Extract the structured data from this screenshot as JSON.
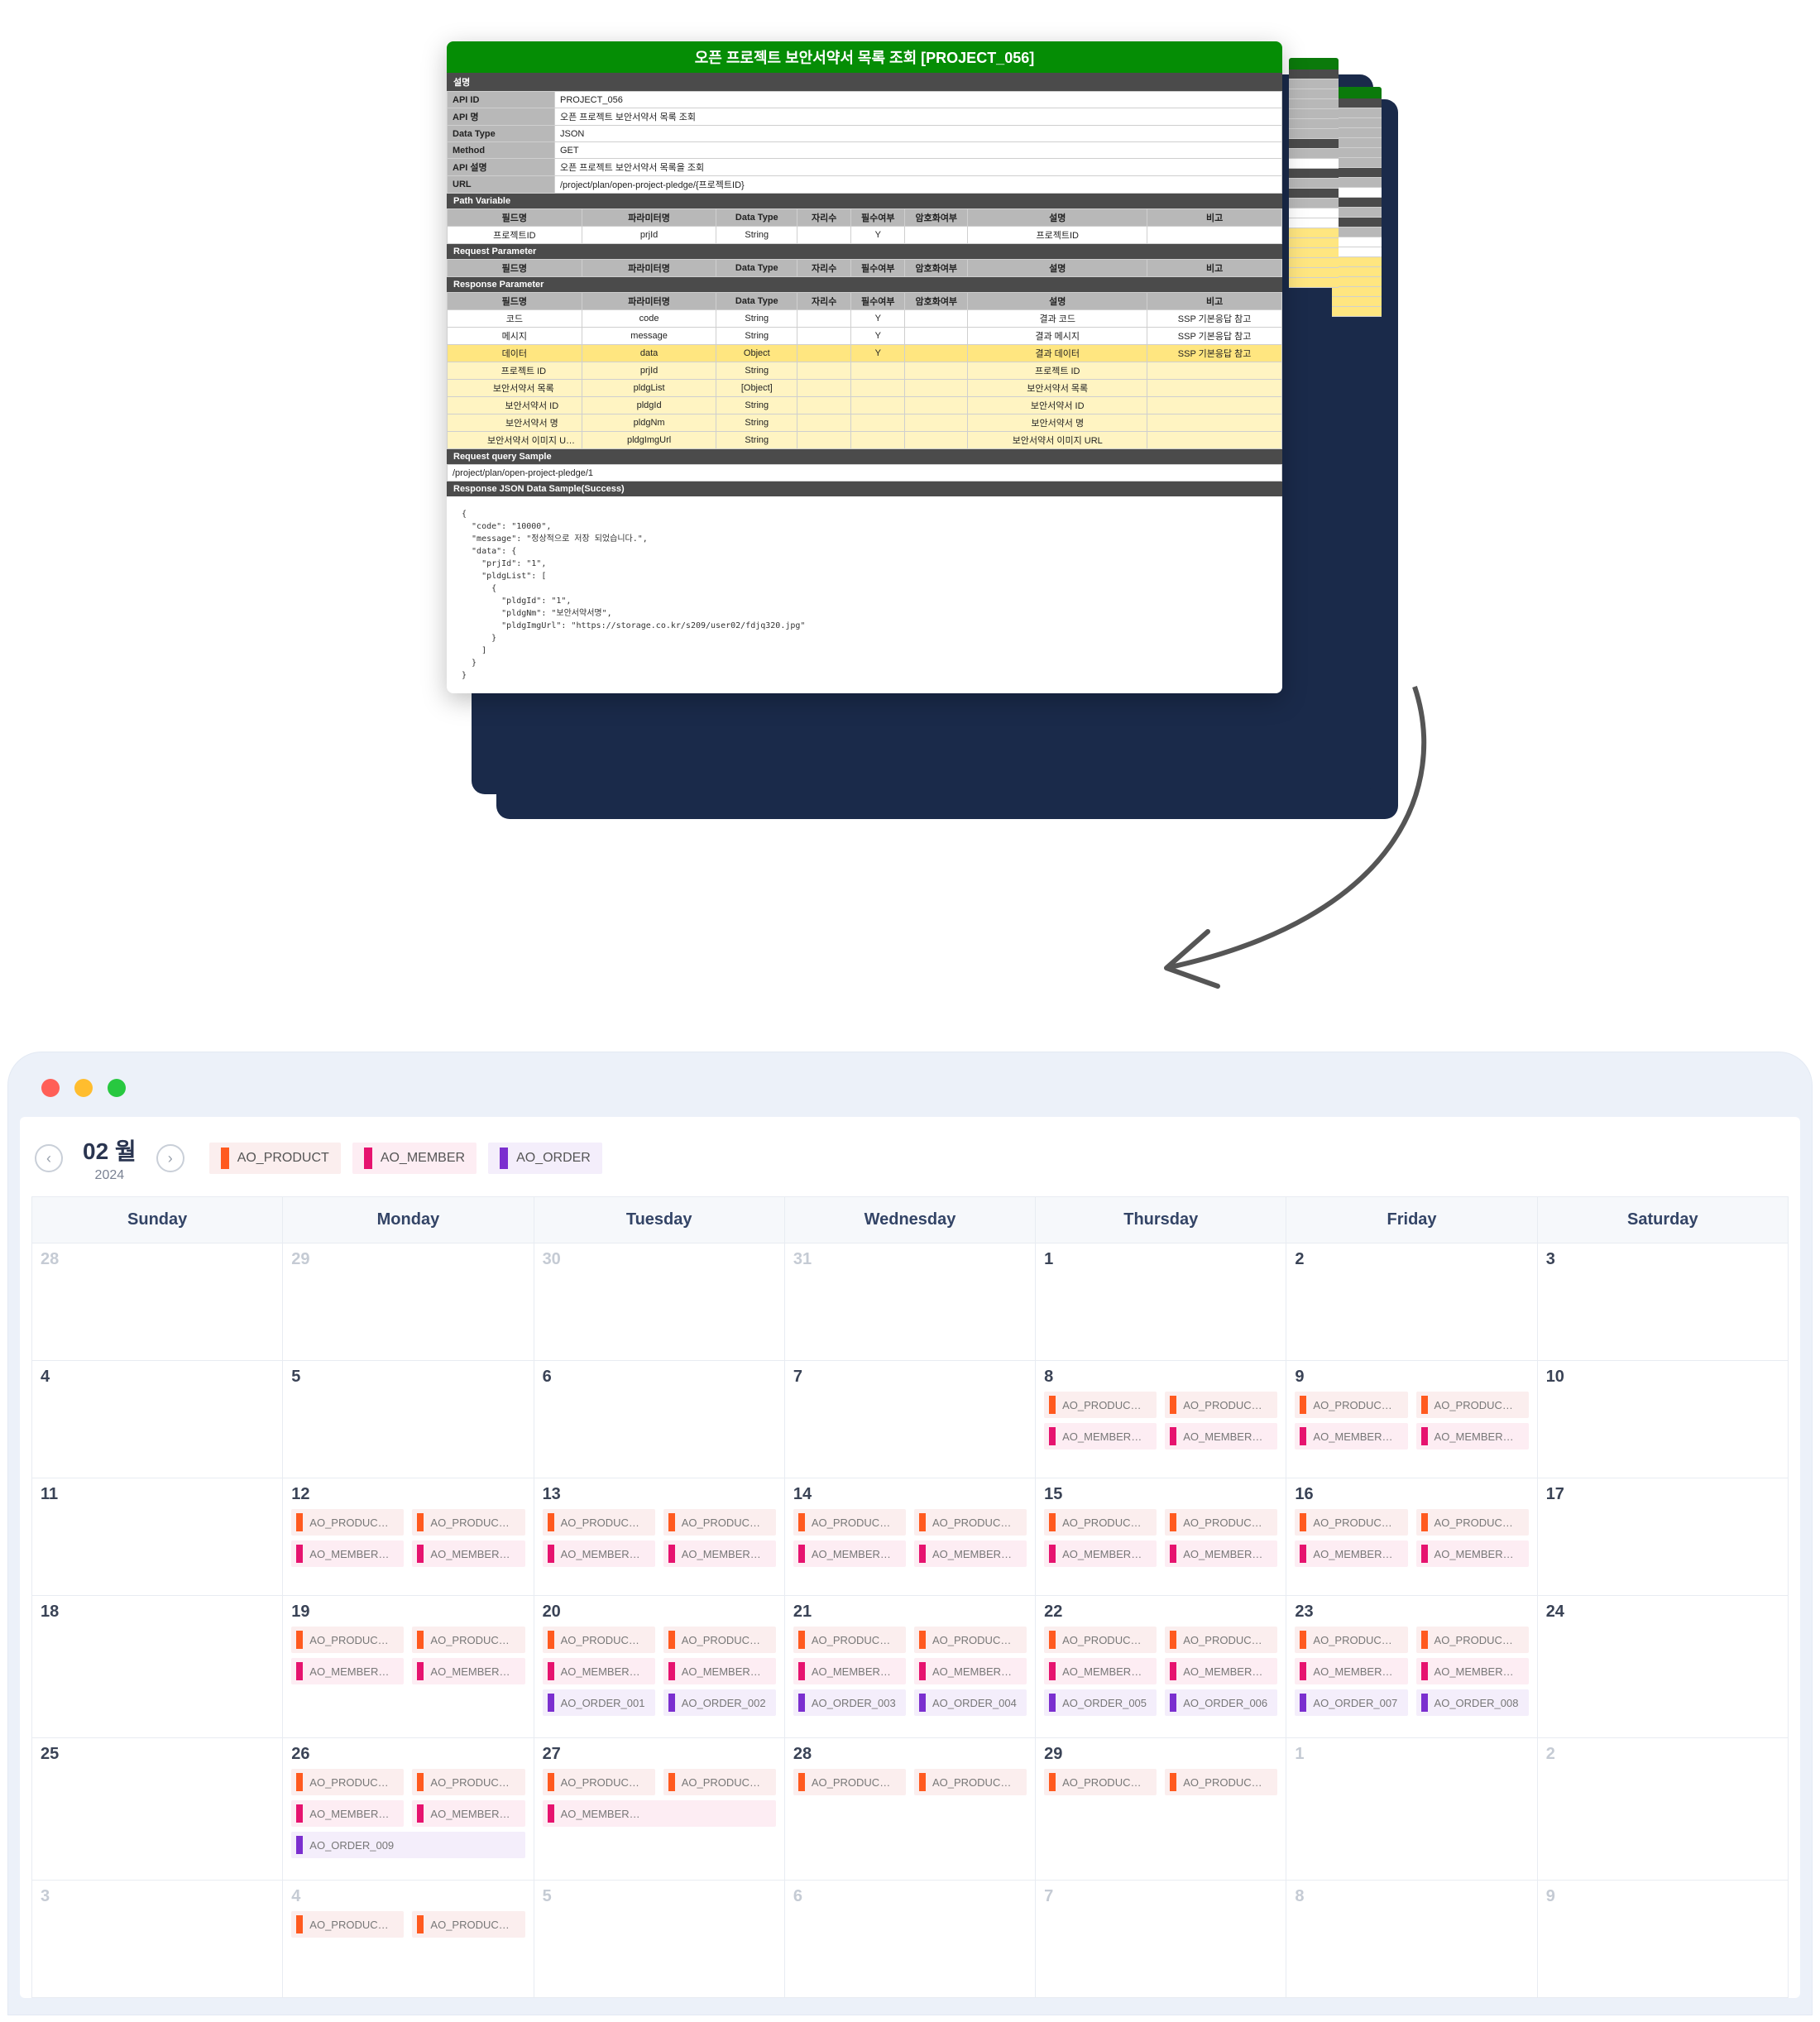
{
  "doc": {
    "title_prefix": "오픈 프로젝트 보안서약서 목록 조회",
    "title_bracket": "[PROJECT_056]",
    "sec_desc": "설명",
    "meta": [
      {
        "k": "API ID",
        "v": "PROJECT_056"
      },
      {
        "k": "API 명",
        "v": "오픈 프로젝트 보안서약서 목록 조회"
      },
      {
        "k": "Data Type",
        "v": "JSON"
      },
      {
        "k": "Method",
        "v": "GET"
      },
      {
        "k": "API 설명",
        "v": "오픈 프로젝트 보안서약서 목록을 조회"
      },
      {
        "k": "URL",
        "v": "/project/plan/open-project-pledge/{프로젝트ID}"
      }
    ],
    "sec_path": "Path Variable",
    "path_hdr": [
      "필드명",
      "파라미터명",
      "Data Type",
      "자리수",
      "필수여부",
      "암호화여부",
      "설명",
      "비고"
    ],
    "path_rows": [
      {
        "c": [
          "프로젝트ID",
          "prjId",
          "String",
          "",
          "Y",
          "",
          "프로젝트ID",
          ""
        ]
      }
    ],
    "sec_req": "Request Parameter",
    "req_hdr": [
      "필드명",
      "파라미터명",
      "Data Type",
      "자리수",
      "필수여부",
      "암호화여부",
      "설명",
      "비고"
    ],
    "sec_resp": "Response Parameter",
    "resp_hdr": [
      "필드명",
      "파라미터명",
      "Data Type",
      "자리수",
      "필수여부",
      "암호화여부",
      "설명",
      "비고"
    ],
    "resp_rows": [
      {
        "cls": "",
        "c": [
          "코드",
          "code",
          "String",
          "",
          "Y",
          "",
          "결과 코드",
          "SSP 기본응답 참고"
        ]
      },
      {
        "cls": "",
        "c": [
          "메시지",
          "message",
          "String",
          "",
          "Y",
          "",
          "결과 메시지",
          "SSP 기본응답 참고"
        ]
      },
      {
        "cls": "yellow",
        "c": [
          "데이터",
          "data",
          "Object",
          "",
          "Y",
          "",
          "결과 데이터",
          "SSP 기본응답 참고"
        ]
      },
      {
        "cls": "lyellow",
        "indent": 1,
        "c": [
          "프로젝트 ID",
          "prjId",
          "String",
          "",
          "",
          "",
          "프로젝트 ID",
          ""
        ]
      },
      {
        "cls": "lyellow",
        "indent": 1,
        "c": [
          "보안서약서 목록",
          "pldgList",
          "[Object]",
          "",
          "",
          "",
          "보안서약서 목록",
          ""
        ]
      },
      {
        "cls": "lyellow",
        "indent": 2,
        "c": [
          "보안서약서 ID",
          "pldgId",
          "String",
          "",
          "",
          "",
          "보안서약서 ID",
          ""
        ]
      },
      {
        "cls": "lyellow",
        "indent": 2,
        "c": [
          "보안서약서 명",
          "pldgNm",
          "String",
          "",
          "",
          "",
          "보안서약서 명",
          ""
        ]
      },
      {
        "cls": "lyellow",
        "indent": 2,
        "c": [
          "보안서약서 이미지 URL",
          "pldgImgUrl",
          "String",
          "",
          "",
          "",
          "보안서약서 이미지 URL",
          ""
        ]
      }
    ],
    "sec_query": "Request query Sample",
    "query_val": "/project/plan/open-project-pledge/1",
    "sec_json": "Response JSON Data Sample(Success)",
    "json_body": "{\n  \"code\": \"10000\",\n  \"message\": \"정상적으로 저장 되었습니다.\",\n  \"data\": {\n    \"prjId\": \"1\",\n    \"pldgList\": [\n      {\n        \"pldgId\": \"1\",\n        \"pldgNm\": \"보안서약서명\",\n        \"pldgImgUrl\": \"https://storage.co.kr/s209/user02/fdjq320.jpg\"\n      }\n    ]\n  }\n}"
  },
  "cal": {
    "month": "02 월",
    "year": "2024",
    "legend": [
      {
        "label": "AO_PRODUCT",
        "cls": "p"
      },
      {
        "label": "AO_MEMBER",
        "cls": "m"
      },
      {
        "label": "AO_ORDER",
        "cls": "o"
      }
    ],
    "dow": [
      "Sunday",
      "Monday",
      "Tuesday",
      "Wednesday",
      "Thursday",
      "Friday",
      "Saturday"
    ],
    "weeks": [
      [
        {
          "d": "28",
          "fade": true
        },
        {
          "d": "29",
          "fade": true
        },
        {
          "d": "30",
          "fade": true
        },
        {
          "d": "31",
          "fade": true
        },
        {
          "d": "1"
        },
        {
          "d": "2"
        },
        {
          "d": "3"
        }
      ],
      [
        {
          "d": "4"
        },
        {
          "d": "5"
        },
        {
          "d": "6"
        },
        {
          "d": "7"
        },
        {
          "d": "8",
          "ev": [
            [
              "p",
              "AO_PRODUC…",
              "p",
              "AO_PRODUC…"
            ],
            [
              "m",
              "AO_MEMBER…",
              "m",
              "AO_MEMBER…"
            ]
          ]
        },
        {
          "d": "9",
          "ev": [
            [
              "p",
              "AO_PRODUC…",
              "p",
              "AO_PRODUC…"
            ],
            [
              "m",
              "AO_MEMBER…",
              "m",
              "AO_MEMBER…"
            ]
          ]
        },
        {
          "d": "10"
        }
      ],
      [
        {
          "d": "11"
        },
        {
          "d": "12",
          "ev": [
            [
              "p",
              "AO_PRODUC…",
              "p",
              "AO_PRODUC…"
            ],
            [
              "m",
              "AO_MEMBER…",
              "m",
              "AO_MEMBER…"
            ]
          ]
        },
        {
          "d": "13",
          "ev": [
            [
              "p",
              "AO_PRODUC…",
              "p",
              "AO_PRODUC…"
            ],
            [
              "m",
              "AO_MEMBER…",
              "m",
              "AO_MEMBER…"
            ]
          ]
        },
        {
          "d": "14",
          "ev": [
            [
              "p",
              "AO_PRODUC…",
              "p",
              "AO_PRODUC…"
            ],
            [
              "m",
              "AO_MEMBER…",
              "m",
              "AO_MEMBER…"
            ]
          ]
        },
        {
          "d": "15",
          "ev": [
            [
              "p",
              "AO_PRODUC…",
              "p",
              "AO_PRODUC…"
            ],
            [
              "m",
              "AO_MEMBER…",
              "m",
              "AO_MEMBER…"
            ]
          ]
        },
        {
          "d": "16",
          "ev": [
            [
              "p",
              "AO_PRODUC…",
              "p",
              "AO_PRODUC…"
            ],
            [
              "m",
              "AO_MEMBER…",
              "m",
              "AO_MEMBER…"
            ]
          ]
        },
        {
          "d": "17"
        }
      ],
      [
        {
          "d": "18"
        },
        {
          "d": "19",
          "ev": [
            [
              "p",
              "AO_PRODUC…",
              "p",
              "AO_PRODUC…"
            ],
            [
              "m",
              "AO_MEMBER…",
              "m",
              "AO_MEMBER…"
            ]
          ]
        },
        {
          "d": "20",
          "ev": [
            [
              "p",
              "AO_PRODUC…",
              "p",
              "AO_PRODUC…"
            ],
            [
              "m",
              "AO_MEMBER…",
              "m",
              "AO_MEMBER…"
            ],
            [
              "o",
              "AO_ORDER_001",
              "o",
              "AO_ORDER_002"
            ]
          ]
        },
        {
          "d": "21",
          "ev": [
            [
              "p",
              "AO_PRODUC…",
              "p",
              "AO_PRODUC…"
            ],
            [
              "m",
              "AO_MEMBER…",
              "m",
              "AO_MEMBER…"
            ],
            [
              "o",
              "AO_ORDER_003",
              "o",
              "AO_ORDER_004"
            ]
          ]
        },
        {
          "d": "22",
          "ev": [
            [
              "p",
              "AO_PRODUC…",
              "p",
              "AO_PRODUC…"
            ],
            [
              "m",
              "AO_MEMBER…",
              "m",
              "AO_MEMBER…"
            ],
            [
              "o",
              "AO_ORDER_005",
              "o",
              "AO_ORDER_006"
            ]
          ]
        },
        {
          "d": "23",
          "ev": [
            [
              "p",
              "AO_PRODUC…",
              "p",
              "AO_PRODUC…"
            ],
            [
              "m",
              "AO_MEMBER…",
              "m",
              "AO_MEMBER…"
            ],
            [
              "o",
              "AO_ORDER_007",
              "o",
              "AO_ORDER_008"
            ]
          ]
        },
        {
          "d": "24"
        }
      ],
      [
        {
          "d": "25"
        },
        {
          "d": "26",
          "ev": [
            [
              "p",
              "AO_PRODUC…",
              "p",
              "AO_PRODUC…"
            ],
            [
              "m",
              "AO_MEMBER…",
              "m",
              "AO_MEMBER…"
            ],
            [
              "o",
              "AO_ORDER_009"
            ]
          ]
        },
        {
          "d": "27",
          "ev": [
            [
              "p",
              "AO_PRODUC…",
              "p",
              "AO_PRODUC…"
            ],
            [
              "m",
              "AO_MEMBER…"
            ]
          ]
        },
        {
          "d": "28",
          "ev": [
            [
              "p",
              "AO_PRODUC…",
              "p",
              "AO_PRODUC…"
            ]
          ]
        },
        {
          "d": "29",
          "ev": [
            [
              "p",
              "AO_PRODUC…",
              "p",
              "AO_PRODUC…"
            ]
          ]
        },
        {
          "d": "1",
          "fade": true
        },
        {
          "d": "2",
          "fade": true
        }
      ],
      [
        {
          "d": "3",
          "fade": true
        },
        {
          "d": "4",
          "fade": true,
          "ev": [
            [
              "p",
              "AO_PRODUC…",
              "p",
              "AO_PRODUC…"
            ]
          ]
        },
        {
          "d": "5",
          "fade": true
        },
        {
          "d": "6",
          "fade": true
        },
        {
          "d": "7",
          "fade": true
        },
        {
          "d": "8",
          "fade": true
        },
        {
          "d": "9",
          "fade": true
        }
      ]
    ]
  }
}
